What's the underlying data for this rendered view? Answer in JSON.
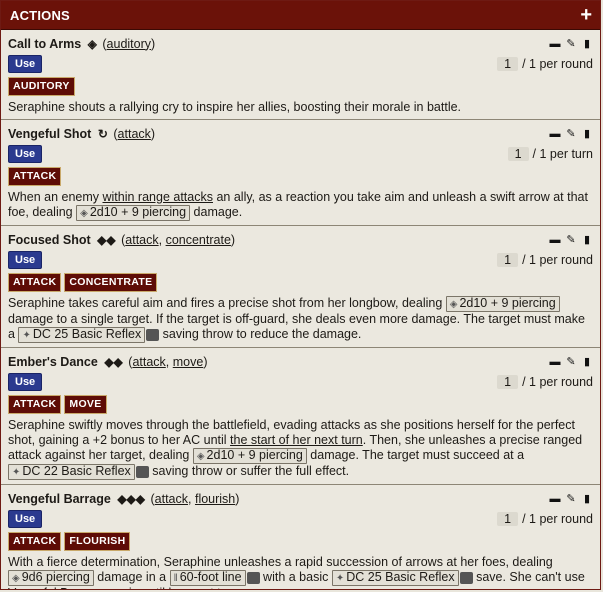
{
  "header": {
    "title": "ACTIONS",
    "add_label": "+"
  },
  "actions": [
    {
      "name": "Call to Arms",
      "action_icon": "◈",
      "tags": [
        "auditory"
      ],
      "use_label": "Use",
      "count": "1",
      "freq": "/ 1 per round",
      "traits": [
        "AUDITORY"
      ],
      "desc": "Seraphine shouts a rallying cry to inspire her allies, boosting their morale in battle."
    },
    {
      "name": "Vengeful Shot",
      "action_icon": "↻",
      "tags": [
        "attack"
      ],
      "use_label": "Use",
      "count": "1",
      "freq": "/ 1 per turn",
      "traits": [
        "ATTACK"
      ],
      "desc_a": "When an enemy ",
      "desc_u": "within range attacks",
      "desc_b": " an ally, as a reaction you take aim and unleash a swift arrow at that foe, dealing ",
      "dmg": "2d10 + 9 piercing",
      "desc_c": " damage."
    },
    {
      "name": "Focused Shot",
      "action_icon": "◆◆",
      "tags": [
        "attack",
        "concentrate"
      ],
      "use_label": "Use",
      "count": "1",
      "freq": "/ 1 per round",
      "traits": [
        "ATTACK",
        "CONCENTRATE"
      ],
      "desc_a": "Seraphine takes careful aim and fires a precise shot from her longbow, dealing ",
      "dmg": "2d10 + 9 piercing",
      "desc_b": " damage to a single target. If the target is off-guard, she deals even more damage. The target must make a ",
      "save": "DC 25 Basic Reflex",
      "desc_c": " saving throw to reduce the damage."
    },
    {
      "name": "Ember's Dance",
      "action_icon": "◆◆",
      "tags": [
        "attack",
        "move"
      ],
      "use_label": "Use",
      "count": "1",
      "freq": "/ 1 per round",
      "traits": [
        "ATTACK",
        "MOVE"
      ],
      "desc_a": "Seraphine swiftly moves through the battlefield, evading attacks as she positions herself for the perfect shot, gaining a +2 bonus to her AC until ",
      "desc_u": "the start of her next turn",
      "desc_b": ". Then, she unleashes a precise ranged attack against her target, dealing ",
      "dmg": "2d10 + 9 piercing",
      "desc_c": " damage. The target must succeed at a ",
      "save": "DC 22 Basic Reflex",
      "desc_d": " saving throw or suffer the full effect."
    },
    {
      "name": "Vengeful Barrage",
      "action_icon": "◆◆◆",
      "tags": [
        "attack",
        "flourish"
      ],
      "use_label": "Use",
      "count": "1",
      "freq": "/ 1 per round",
      "traits": [
        "ATTACK",
        "FLOURISH"
      ],
      "desc_a": "With a fierce determination, Seraphine unleashes a rapid succession of arrows at her foes, dealing ",
      "dmg": "9d6 piercing",
      "desc_b": " damage in a ",
      "area": "60-foot line",
      "desc_c": " with a basic ",
      "save": "DC 25 Basic Reflex",
      "desc_d": " save. She can't use Vengeful Barrage again until her next turn."
    }
  ]
}
